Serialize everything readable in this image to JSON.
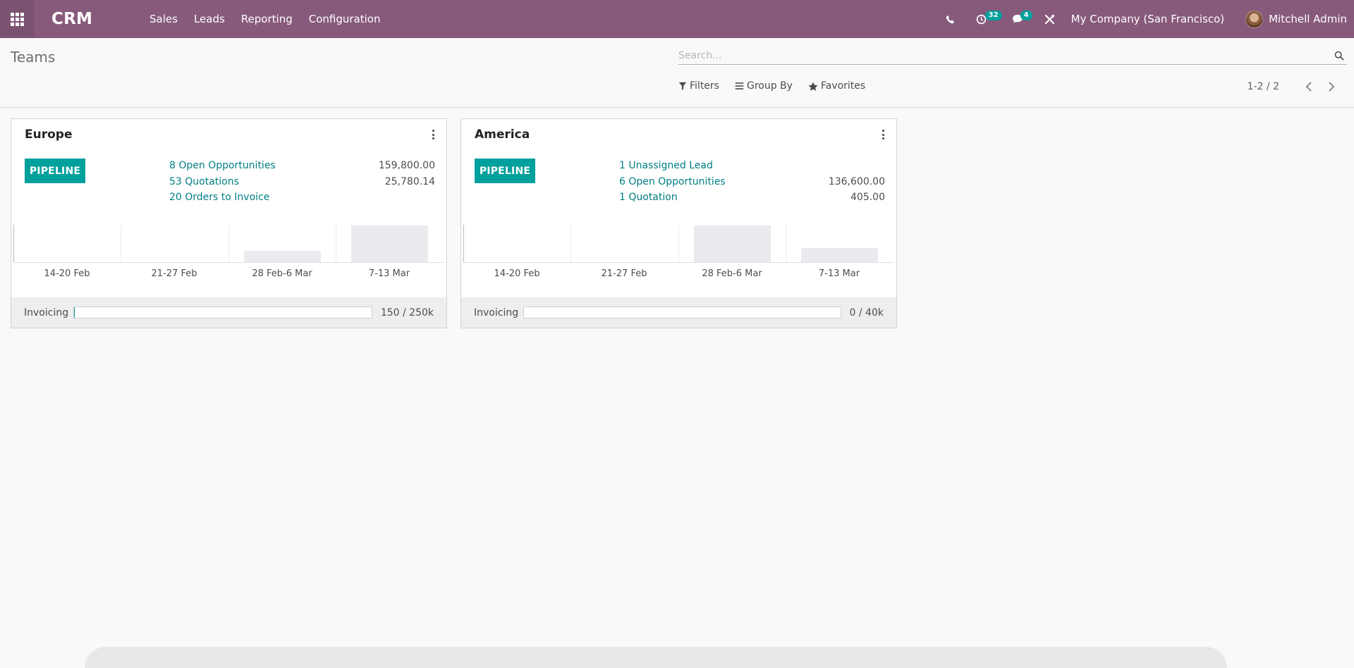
{
  "navbar": {
    "brand": "CRM",
    "menu": [
      "Sales",
      "Leads",
      "Reporting",
      "Configuration"
    ],
    "activities_count": "32",
    "messages_count": "4",
    "company": "My Company (San Francisco)",
    "user": "Mitchell Admin"
  },
  "control_panel": {
    "title": "Teams",
    "search_placeholder": "Search...",
    "filters_label": "Filters",
    "groupby_label": "Group By",
    "favorites_label": "Favorites",
    "pager_value": "1-2 / 2"
  },
  "cards": [
    {
      "title": "Europe",
      "pipeline_label": "PIPELINE",
      "stats": [
        {
          "label": "8 Open Opportunities",
          "value": "159,800.00"
        },
        {
          "label": "53 Quotations",
          "value": "25,780.14"
        },
        {
          "label": "20 Orders to Invoice",
          "value": ""
        }
      ],
      "graph_labels": [
        "14-20 Feb",
        "21-27 Feb",
        "28 Feb-6 Mar",
        "7-13 Mar"
      ],
      "graph_values": [
        0,
        0,
        0.3,
        1
      ],
      "footer_label": "Invoicing",
      "footer_value": "150 / 250k",
      "progress": 0.0006
    },
    {
      "title": "America",
      "pipeline_label": "PIPELINE",
      "stats": [
        {
          "label": "1 Unassigned Lead",
          "value": ""
        },
        {
          "label": "6 Open Opportunities",
          "value": "136,600.00"
        },
        {
          "label": "1 Quotation",
          "value": "405.00"
        }
      ],
      "graph_labels": [
        "14-20 Feb",
        "21-27 Feb",
        "28 Feb-6 Mar",
        "7-13 Mar"
      ],
      "graph_values": [
        0,
        0,
        1,
        0.38
      ],
      "footer_label": "Invoicing",
      "footer_value": "0 / 40k",
      "progress": 0
    }
  ]
}
